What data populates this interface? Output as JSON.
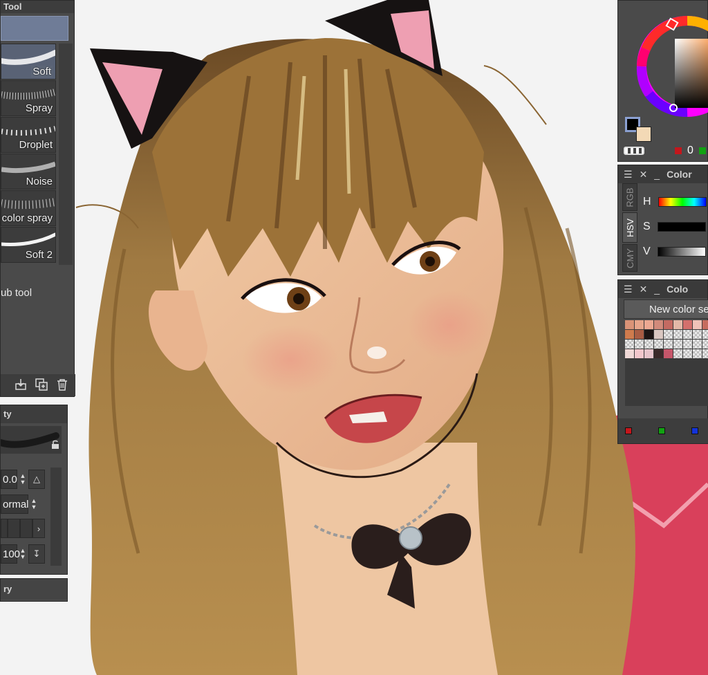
{
  "subtool_palette": {
    "title": "Tool",
    "brushes": [
      {
        "label": "Soft",
        "active": true
      },
      {
        "label": "Spray",
        "active": false
      },
      {
        "label": "Droplet",
        "active": false
      },
      {
        "label": "Noise",
        "active": false
      },
      {
        "label": "color spray",
        "active": false
      },
      {
        "label": "Soft 2",
        "active": false
      }
    ],
    "add_sub_tool_label": "ub tool",
    "footer_icons": [
      "import-icon",
      "duplicate-icon",
      "trash-icon"
    ]
  },
  "tool_property": {
    "title": "ty",
    "brush_size_value": "0.0",
    "blend_mode": "ormal",
    "opacity_value": "100"
  },
  "brush_size_palette": {
    "title": "ry"
  },
  "color_wheel": {
    "main_color": "#000000",
    "sub_color": "#f3d9b6",
    "counter": "0",
    "hue_ring_marker": "orange"
  },
  "color_slider": {
    "title": "Color",
    "tabs": [
      "RGB",
      "HSV",
      "CMY"
    ],
    "active_tab": "HSV",
    "rows": [
      {
        "label": "H"
      },
      {
        "label": "S"
      },
      {
        "label": "V"
      }
    ]
  },
  "color_set": {
    "title": "Colo",
    "set_name": "New color se",
    "swatches": [
      "#d99377",
      "#e6a58b",
      "#eca892",
      "#d18a7b",
      "#c46a62",
      "#e3b9a8",
      "#d3706c",
      "#f0c3b8",
      "#c66c5f",
      "#cf7b4d",
      "#a95c43",
      "#1d1514",
      "#d9c7c1",
      "empty",
      "empty",
      "empty",
      "empty",
      "empty",
      "empty",
      "empty",
      "empty",
      "empty",
      "empty",
      "empty",
      "empty",
      "empty",
      "empty",
      "#efd8d6",
      "#f2c7cc",
      "#e7c4cb",
      "#3b2929",
      "#c6566a",
      "empty",
      "empty",
      "empty",
      "empty"
    ],
    "footer_colors": [
      "#c4161c",
      "#12a212",
      "#1333d8"
    ]
  }
}
